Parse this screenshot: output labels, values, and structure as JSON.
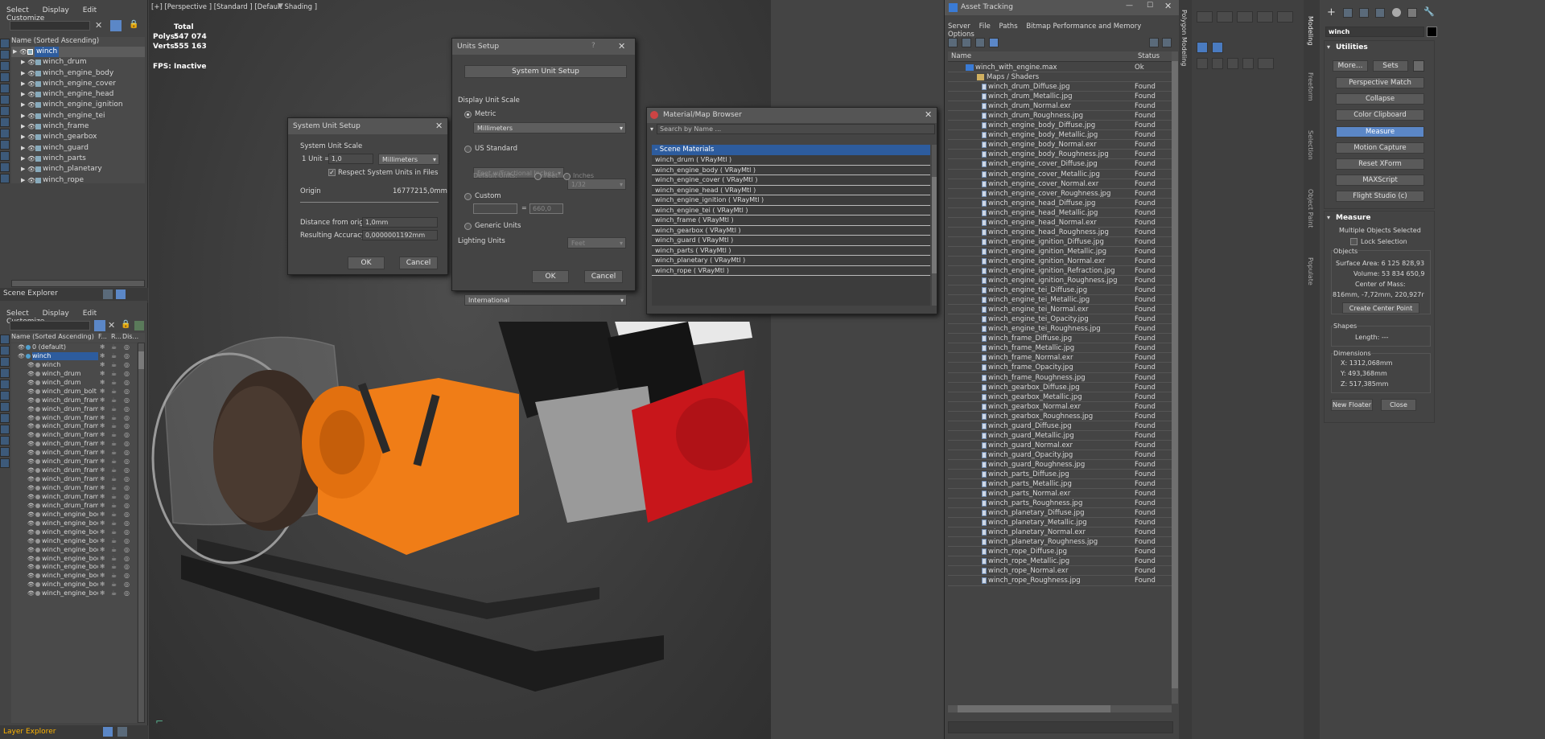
{
  "scene_explorer_top": {
    "menu": [
      "Select",
      "Display",
      "Edit",
      "Customize"
    ],
    "column_header": "Name (Sorted Ascending)",
    "items": [
      "winch",
      "winch_drum",
      "winch_engine_body",
      "winch_engine_cover",
      "winch_engine_head",
      "winch_engine_ignition",
      "winch_engine_tei",
      "winch_frame",
      "winch_gearbox",
      "winch_guard",
      "winch_parts",
      "winch_planetary",
      "winch_rope"
    ],
    "footer_title": "Scene Explorer"
  },
  "layer_explorer": {
    "menu": [
      "Select",
      "Display",
      "Edit",
      "Customize"
    ],
    "columns": [
      "Name (Sorted Ascending)",
      "F...",
      "R...",
      "Dis..."
    ],
    "items": [
      "0 (default)",
      "winch",
      "winch",
      "winch_drum",
      "winch_drum",
      "winch_drum_bolt",
      "winch_drum_frame_...",
      "winch_drum_frame_...",
      "winch_drum_frame_l...",
      "winch_drum_frame_l...",
      "winch_drum_frame_l...",
      "winch_drum_frame_l...",
      "winch_drum_frame_...",
      "winch_drum_frame_...",
      "winch_drum_frame_...",
      "winch_drum_frame_...",
      "winch_drum_frame_...",
      "winch_drum_frame_...",
      "winch_drum_frame_top",
      "winch_engine_body",
      "winch_engine_body_...",
      "winch_engine_body_...",
      "winch_engine_body_...",
      "winch_engine_body_...",
      "winch_engine_body_...",
      "winch_engine_body_...",
      "winch_engine_body_...",
      "winch_engine_body_...",
      "winch_engine_body_..."
    ],
    "footer_title": "Layer Explorer"
  },
  "viewport": {
    "label": "[+] [Perspective ] [Standard ] [Default Shading ]",
    "stats_total": "Total",
    "polys_label": "Polys:",
    "polys_value": "547 074",
    "verts_label": "Verts:",
    "verts_value": "555 163",
    "fps_label": "FPS:",
    "fps_value": "Inactive"
  },
  "system_unit_setup": {
    "title": "System Unit Setup",
    "group": "System Unit Scale",
    "unit_label": "1 Unit =",
    "unit_value": "1,0",
    "unit_select": "Millimeters",
    "respect_label": "Respect System Units in Files",
    "origin_label": "Origin",
    "origin_value": "16777215,0mm",
    "distance_label": "Distance from origin:",
    "distance_value": "1,0mm",
    "accuracy_label": "Resulting Accuracy:",
    "accuracy_value": "0,0000001192mm",
    "ok": "OK",
    "cancel": "Cancel"
  },
  "units_setup": {
    "title": "Units Setup",
    "help": "?",
    "system_button": "System Unit Setup",
    "display_scale": "Display Unit Scale",
    "metric": "Metric",
    "metric_select": "Millimeters",
    "us_standard": "US Standard",
    "us_select": "Feet w/Fractional Inches",
    "us_frac": "1/32",
    "default_units": "Default Units:",
    "feet": "Feet",
    "inches": "Inches",
    "custom": "Custom",
    "custom_value": "660,0",
    "custom_unit": "Feet",
    "generic": "Generic Units",
    "lighting": "Lighting Units",
    "lighting_select": "International",
    "ok": "OK",
    "cancel": "Cancel"
  },
  "material_browser": {
    "title": "Material/Map Browser",
    "search_placeholder": "Search by Name ...",
    "group": "- Scene Materials",
    "materials": [
      "winch_drum  ( VRayMtl )",
      "winch_engine_body  ( VRayMtl )",
      "winch_engine_cover  ( VRayMtl )",
      "winch_engine_head  ( VRayMtl )",
      "winch_engine_ignition  ( VRayMtl )",
      "winch_engine_tei  ( VRayMtl )",
      "winch_frame  ( VRayMtl )",
      "winch_gearbox  ( VRayMtl )",
      "winch_guard  ( VRayMtl )",
      "winch_parts  ( VRayMtl )",
      "winch_planetary  ( VRayMtl )",
      "winch_rope  ( VRayMtl )"
    ]
  },
  "asset_tracking": {
    "title": "Asset Tracking",
    "menu": [
      "Server",
      "File",
      "Paths",
      "Bitmap Performance and Memory",
      "Options"
    ],
    "col_name": "Name",
    "col_status": "Status",
    "root_file": "winch_with_engine.max",
    "root_status": "Ok",
    "maps_folder": "Maps / Shaders",
    "files": [
      "winch_drum_Diffuse.jpg",
      "winch_drum_Metallic.jpg",
      "winch_drum_Normal.exr",
      "winch_drum_Roughness.jpg",
      "winch_engine_body_Diffuse.jpg",
      "winch_engine_body_Metallic.jpg",
      "winch_engine_body_Normal.exr",
      "winch_engine_body_Roughness.jpg",
      "winch_engine_cover_Diffuse.jpg",
      "winch_engine_cover_Metallic.jpg",
      "winch_engine_cover_Normal.exr",
      "winch_engine_cover_Roughness.jpg",
      "winch_engine_head_Diffuse.jpg",
      "winch_engine_head_Metallic.jpg",
      "winch_engine_head_Normal.exr",
      "winch_engine_head_Roughness.jpg",
      "winch_engine_ignition_Diffuse.jpg",
      "winch_engine_ignition_Metallic.jpg",
      "winch_engine_ignition_Normal.exr",
      "winch_engine_ignition_Refraction.jpg",
      "winch_engine_ignition_Roughness.jpg",
      "winch_engine_tei_Diffuse.jpg",
      "winch_engine_tei_Metallic.jpg",
      "winch_engine_tei_Normal.exr",
      "winch_engine_tei_Opacity.jpg",
      "winch_engine_tei_Roughness.jpg",
      "winch_frame_Diffuse.jpg",
      "winch_frame_Metallic.jpg",
      "winch_frame_Normal.exr",
      "winch_frame_Opacity.jpg",
      "winch_frame_Roughness.jpg",
      "winch_gearbox_Diffuse.jpg",
      "winch_gearbox_Metallic.jpg",
      "winch_gearbox_Normal.exr",
      "winch_gearbox_Roughness.jpg",
      "winch_guard_Diffuse.jpg",
      "winch_guard_Metallic.jpg",
      "winch_guard_Normal.exr",
      "winch_guard_Opacity.jpg",
      "winch_guard_Roughness.jpg",
      "winch_parts_Diffuse.jpg",
      "winch_parts_Metallic.jpg",
      "winch_parts_Normal.exr",
      "winch_parts_Roughness.jpg",
      "winch_planetary_Diffuse.jpg",
      "winch_planetary_Metallic.jpg",
      "winch_planetary_Normal.exr",
      "winch_planetary_Roughness.jpg",
      "winch_rope_Diffuse.jpg",
      "winch_rope_Metallic.jpg",
      "winch_rope_Normal.exr",
      "winch_rope_Roughness.jpg"
    ],
    "file_status": "Found"
  },
  "side_tabs": [
    "Polygon Modeling",
    "Modeling",
    "Freeform",
    "Selection",
    "Object Paint",
    "Populate"
  ],
  "command_panel": {
    "object_name": "winch",
    "utilities_title": "Utilities",
    "more": "More...",
    "sets": "Sets",
    "buttons": [
      "Perspective Match",
      "Collapse",
      "Color Clipboard",
      "Measure",
      "Motion Capture",
      "Reset XForm",
      "MAXScript",
      "Flight Studio (c)"
    ],
    "measure_title": "Measure",
    "multiple_selected": "Multiple Objects Selected",
    "lock_selection": "Lock Selection",
    "objects_label": "Objects",
    "surface_area": "Surface Area:  6 125 828,93",
    "volume": "Volume:  53 834 650,9",
    "center_of_mass": "Center of Mass:",
    "center_value": "816mm, -7,72mm, 220,927r",
    "create_center": "Create Center Point",
    "shapes_label": "Shapes",
    "length": "Length:  ---",
    "dimensions_label": "Dimensions",
    "dim_x": "X:   1312,068mm",
    "dim_y": "Y:   493,368mm",
    "dim_z": "Z:   517,385mm",
    "new_floater": "New Floater",
    "close": "Close"
  },
  "colors": {
    "selection_blue": "#2d5c9e",
    "highlight_button": "#5b87c7",
    "engine_red": "#c8161b",
    "gearbox_orange": "#f07d17"
  }
}
